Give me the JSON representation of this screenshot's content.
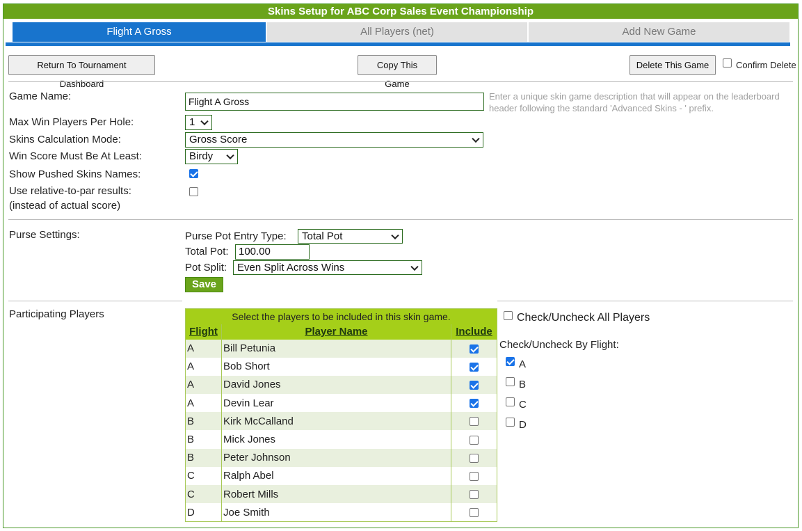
{
  "header": {
    "title": "Skins Setup for ABC Corp Sales Event Championship"
  },
  "tabs": [
    {
      "label": "Flight A Gross",
      "active": true
    },
    {
      "label": "All Players (net)",
      "active": false
    },
    {
      "label": "Add New Game",
      "active": false
    }
  ],
  "toolbar": {
    "return_label": "Return To Tournament Dashboard",
    "copy_label": "Copy This Game",
    "delete_label": "Delete This Game",
    "confirm_delete_label": "Confirm Delete",
    "confirm_delete_checked": false
  },
  "game": {
    "name_label": "Game Name:",
    "name_value": "Flight A Gross",
    "name_hint": "Enter a unique skin game description that will appear on the leaderboard header following the standard 'Advanced Skins - ' prefix.",
    "max_win_label": "Max Win Players Per Hole:",
    "max_win_value": "1",
    "calc_mode_label": "Skins Calculation Mode:",
    "calc_mode_value": "Gross Score",
    "win_score_label": "Win Score Must Be At Least:",
    "win_score_value": "Birdy",
    "show_pushed_label": "Show Pushed Skins Names:",
    "show_pushed_checked": true,
    "relative_label_1": "Use relative-to-par results:",
    "relative_label_2": "(instead of actual score)",
    "relative_checked": false
  },
  "purse": {
    "section_label": "Purse Settings:",
    "entry_type_label": "Purse Pot Entry Type:",
    "entry_type_value": "Total Pot",
    "total_pot_label": "Total Pot:",
    "total_pot_value": "100.00",
    "pot_split_label": "Pot Split:",
    "pot_split_value": "Even Split Across Wins",
    "save_label": "Save"
  },
  "participants": {
    "section_label": "Participating Players",
    "table_caption": "Select the players to be included in this skin game.",
    "columns": [
      "Flight",
      "Player Name",
      "Include"
    ],
    "players": [
      {
        "flight": "A",
        "name": "Bill Petunia",
        "include": true
      },
      {
        "flight": "A",
        "name": "Bob Short",
        "include": true
      },
      {
        "flight": "A",
        "name": "David Jones",
        "include": true
      },
      {
        "flight": "A",
        "name": "Devin Lear",
        "include": true
      },
      {
        "flight": "B",
        "name": "Kirk McCalland",
        "include": false
      },
      {
        "flight": "B",
        "name": "Mick Jones",
        "include": false
      },
      {
        "flight": "B",
        "name": "Peter Johnson",
        "include": false
      },
      {
        "flight": "C",
        "name": "Ralph Abel",
        "include": false
      },
      {
        "flight": "C",
        "name": "Robert Mills",
        "include": false
      },
      {
        "flight": "D",
        "name": "Joe Smith",
        "include": false
      }
    ],
    "check_all_label": "Check/Uncheck All Players",
    "check_all_checked": false,
    "by_flight_label": "Check/Uncheck By Flight:",
    "flights": [
      {
        "label": "A",
        "checked": true
      },
      {
        "label": "B",
        "checked": false
      },
      {
        "label": "C",
        "checked": false
      },
      {
        "label": "D",
        "checked": false
      }
    ]
  },
  "colors": {
    "brand_green": "#6aa41b",
    "tab_blue": "#1874cd",
    "table_header_green": "#a5cf19"
  }
}
